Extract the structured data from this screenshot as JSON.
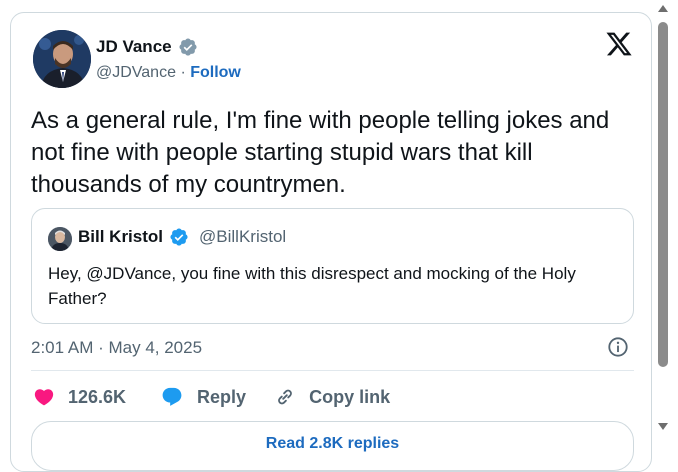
{
  "tweet": {
    "author": {
      "name": "JD Vance",
      "handle": "@JDVance",
      "separator": "·",
      "follow_label": "Follow",
      "verified_color": "#829aab"
    },
    "text": "As a general rule, I'm fine with people telling jokes and not fine with people starting stupid wars that kill thousands of my countrymen.",
    "timestamp": "2:01 AM · May 4, 2025",
    "quoted": {
      "name": "Bill Kristol",
      "handle": "@BillKristol",
      "verified_color": "#1d9bf0",
      "text": "Hey, @JDVance, you fine with this disrespect and mocking of the Holy Father?"
    },
    "actions": {
      "likes": "126.6K",
      "reply_label": "Reply",
      "copy_link_label": "Copy link"
    },
    "read_replies_label": "Read 2.8K replies"
  },
  "colors": {
    "like": "#f91880",
    "reply": "#1d9bf0",
    "link": "#1d6bbf"
  },
  "icons": [
    "x-logo-icon",
    "verified-badge-icon",
    "info-icon",
    "heart-icon",
    "reply-bubble-icon",
    "link-icon",
    "scroll-up-arrow-icon",
    "scroll-down-arrow-icon"
  ]
}
